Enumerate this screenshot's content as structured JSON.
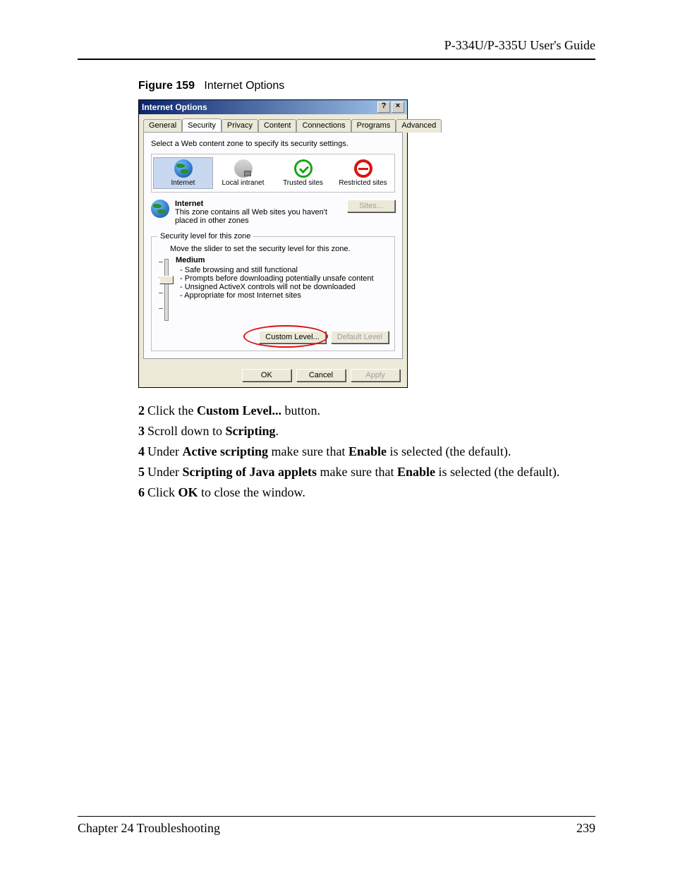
{
  "header": {
    "guide_title": "P-334U/P-335U User's Guide"
  },
  "figure": {
    "label": "Figure 159",
    "title": "Internet Options"
  },
  "dialog": {
    "title": "Internet Options",
    "help": "?",
    "close": "×",
    "tabs": [
      "General",
      "Security",
      "Privacy",
      "Content",
      "Connections",
      "Programs",
      "Advanced"
    ],
    "active_tab_index": 1,
    "zone_instruction": "Select a Web content zone to specify its security settings.",
    "zones": [
      {
        "name": "Internet",
        "icon": "internet",
        "selected": true
      },
      {
        "name": "Local intranet",
        "icon": "intranet",
        "selected": false
      },
      {
        "name": "Trusted sites",
        "icon": "trusted",
        "selected": false
      },
      {
        "name": "Restricted sites",
        "icon": "restricted",
        "selected": false
      }
    ],
    "selected_zone_name": "Internet",
    "selected_zone_desc": "This zone contains all Web sites you haven't placed in other zones",
    "sites_button": "Sites...",
    "sites_button_enabled": false,
    "security_group_label": "Security level for this zone",
    "security_move_hint": "Move the slider to set the security level for this zone.",
    "security_level_name": "Medium",
    "security_level_bullets": [
      "Safe browsing and still functional",
      "Prompts before downloading potentially unsafe content",
      "Unsigned ActiveX controls will not be downloaded",
      "Appropriate for most Internet sites"
    ],
    "custom_level_button": "Custom Level...",
    "default_level_button": "Default Level",
    "default_level_enabled": false,
    "ok_button": "OK",
    "cancel_button": "Cancel",
    "apply_button": "Apply",
    "apply_button_enabled": false
  },
  "steps": [
    {
      "n": "2",
      "parts": [
        "Click the ",
        {
          "b": "Custom Level..."
        },
        " button."
      ]
    },
    {
      "n": "3",
      "parts": [
        "Scroll down to ",
        {
          "b": "Scripting"
        },
        "."
      ]
    },
    {
      "n": "4",
      "parts": [
        "Under ",
        {
          "b": "Active scripting"
        },
        " make sure that ",
        {
          "b": "Enable"
        },
        " is selected (the default)."
      ]
    },
    {
      "n": "5",
      "parts": [
        "Under ",
        {
          "b": "Scripting of Java applets"
        },
        " make sure that ",
        {
          "b": "Enable"
        },
        " is selected (the default)."
      ]
    },
    {
      "n": "6",
      "parts": [
        "Click ",
        {
          "b": "OK"
        },
        " to close the window."
      ]
    }
  ],
  "footer": {
    "chapter": "Chapter 24 Troubleshooting",
    "page": "239"
  }
}
